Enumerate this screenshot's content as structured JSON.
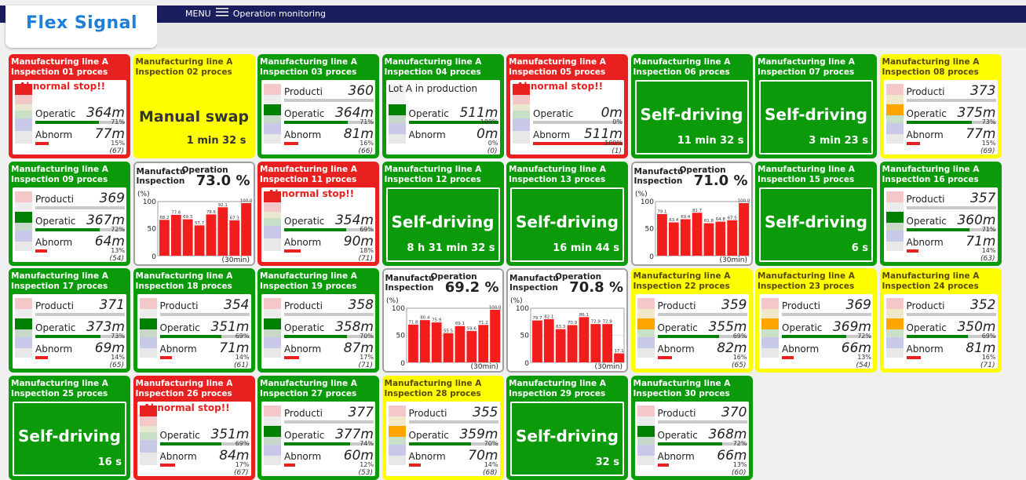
{
  "header": {
    "logo": "Flex Signal",
    "menu_label": "MENU",
    "page_title": "Operation monitoring"
  },
  "labels": {
    "production": "Producti",
    "operation": "Operatic",
    "abnormal": "Abnorm",
    "abnormal_stop": "Abnormal stop!!",
    "self_driving": "Self-driving",
    "manual_swap": "Manual swap",
    "chart_line": "Manufactu",
    "chart_inspection": "Inspection",
    "chart_operation": "Operation",
    "chart_unit": "(%)",
    "chart_interval": "(30min)"
  },
  "colors": {
    "green": "#0a9a0a",
    "red": "#e82020",
    "yellow": "#ffff00",
    "navy": "#1a1e5e"
  },
  "cards": [
    {
      "line": "Manufacturing line A",
      "insp": "Inspection 01 proces",
      "color": "red",
      "kind": "abnormal",
      "op": "364m",
      "op_pct": "71%",
      "op_frac": 0.71,
      "ab": "77m",
      "ab_pct": "15%",
      "ab_frac": 0.15,
      "count": "(67)"
    },
    {
      "line": "Manufacturing line A",
      "insp": "Inspection 02 proces",
      "color": "yellow",
      "kind": "manual",
      "time": "1 min 32 s"
    },
    {
      "line": "Manufacturing line A",
      "insp": "Inspection 03 proces",
      "color": "green",
      "kind": "prod",
      "prod": "360",
      "prod_frac": 1,
      "op": "364m",
      "op_pct": "71%",
      "op_frac": 0.71,
      "ab": "81m",
      "ab_pct": "16%",
      "ab_frac": 0.16,
      "count": "(66)"
    },
    {
      "line": "Manufacturing line A",
      "insp": "Inspection 04 proces",
      "color": "green",
      "kind": "lot",
      "lot": "Lot A in production",
      "op": "511m",
      "op_pct": "100%",
      "op_frac": 1,
      "ab": "0m",
      "ab_pct": "0%",
      "ab_frac": 0,
      "count": "(0)"
    },
    {
      "line": "Manufacturing line A",
      "insp": "Inspection 05 proces",
      "color": "red",
      "kind": "abnormal",
      "op": "0m",
      "op_pct": "0%",
      "op_frac": 0,
      "ab": "511m",
      "ab_pct": "100%",
      "ab_frac": 1,
      "count": "(1)"
    },
    {
      "line": "Manufacturing line A",
      "insp": "Inspection 06 proces",
      "color": "green",
      "kind": "self",
      "time": "11 min 32 s"
    },
    {
      "line": "Manufacturing line A",
      "insp": "Inspection 07 proces",
      "color": "green",
      "kind": "self",
      "time": "3 min 23 s"
    },
    {
      "line": "Manufacturing line A",
      "insp": "Inspection 08 proces",
      "color": "yellow",
      "kind": "prod",
      "prod": "373",
      "prod_frac": 1,
      "op": "375m",
      "op_pct": "73%",
      "op_frac": 0.73,
      "ab": "77m",
      "ab_pct": "15%",
      "ab_frac": 0.15,
      "count": "(69)"
    },
    {
      "line": "Manufacturing line A",
      "insp": "Inspection 09 proces",
      "color": "green",
      "kind": "prod",
      "prod": "369",
      "prod_frac": 1,
      "op": "367m",
      "op_pct": "72%",
      "op_frac": 0.72,
      "ab": "64m",
      "ab_pct": "13%",
      "ab_frac": 0.13,
      "count": "(54)"
    },
    {
      "kind": "chart",
      "color": "gray",
      "rate": "73.0 %",
      "bars": [
        68.2,
        77.6,
        69.3,
        57.7,
        78.6,
        92.1,
        67.3,
        100.0
      ]
    },
    {
      "line": "Manufacturing line A",
      "insp": "Inspection 11 proces",
      "color": "red",
      "kind": "abnormal",
      "op": "354m",
      "op_pct": "69%",
      "op_frac": 0.69,
      "ab": "90m",
      "ab_pct": "18%",
      "ab_frac": 0.18,
      "count": "(71)"
    },
    {
      "line": "Manufacturing line A",
      "insp": "Inspection 12 proces",
      "color": "green",
      "kind": "self",
      "time": "8 h 31 min 32 s"
    },
    {
      "line": "Manufacturing line A",
      "insp": "Inspection 13 proces",
      "color": "green",
      "kind": "self",
      "time": "16 min 44 s"
    },
    {
      "kind": "chart",
      "color": "gray",
      "rate": "71.0 %",
      "bars": [
        79.1,
        63.4,
        69.4,
        81.7,
        61.8,
        64.8,
        67.5,
        100.0
      ]
    },
    {
      "line": "Manufacturing line A",
      "insp": "Inspection 15 proces",
      "color": "green",
      "kind": "self",
      "time": "6 s"
    },
    {
      "line": "Manufacturing line A",
      "insp": "Inspection 16 proces",
      "color": "green",
      "kind": "prod",
      "prod": "357",
      "prod_frac": 1,
      "op": "360m",
      "op_pct": "71%",
      "op_frac": 0.71,
      "ab": "71m",
      "ab_pct": "14%",
      "ab_frac": 0.14,
      "count": "(63)"
    },
    {
      "line": "Manufacturing line A",
      "insp": "Inspection 17 proces",
      "color": "green",
      "kind": "prod",
      "prod": "371",
      "prod_frac": 1,
      "op": "373m",
      "op_pct": "73%",
      "op_frac": 0.73,
      "ab": "69m",
      "ab_pct": "14%",
      "ab_frac": 0.14,
      "count": "(65)"
    },
    {
      "line": "Manufacturing line A",
      "insp": "Inspection 18 proces",
      "color": "green",
      "kind": "prod",
      "prod": "354",
      "prod_frac": 1,
      "op": "351m",
      "op_pct": "69%",
      "op_frac": 0.69,
      "ab": "71m",
      "ab_pct": "14%",
      "ab_frac": 0.14,
      "count": "(61)"
    },
    {
      "line": "Manufacturing line A",
      "insp": "Inspection 19 proces",
      "color": "green",
      "kind": "prod",
      "prod": "358",
      "prod_frac": 1,
      "op": "358m",
      "op_pct": "70%",
      "op_frac": 0.7,
      "ab": "87m",
      "ab_pct": "17%",
      "ab_frac": 0.17,
      "count": "(71)"
    },
    {
      "kind": "chart",
      "color": "gray",
      "rate": "69.2 %",
      "bars": [
        71.8,
        80.4,
        75.9,
        55.5,
        69.1,
        59.6,
        71.2,
        100.0
      ]
    },
    {
      "kind": "chart",
      "color": "gray",
      "rate": "70.8 %",
      "bars": [
        79.7,
        82.1,
        63.3,
        70.9,
        86.1,
        72.9,
        72.9,
        17.1
      ]
    },
    {
      "line": "Manufacturing line A",
      "insp": "Inspection 22 proces",
      "color": "yellow",
      "kind": "prod",
      "prod": "359",
      "prod_frac": 1,
      "op": "355m",
      "op_pct": "69%",
      "op_frac": 0.69,
      "ab": "82m",
      "ab_pct": "16%",
      "ab_frac": 0.16,
      "count": "(65)"
    },
    {
      "line": "Manufacturing line A",
      "insp": "Inspection 23 proces",
      "color": "yellow",
      "kind": "prod",
      "prod": "369",
      "prod_frac": 1,
      "op": "369m",
      "op_pct": "72%",
      "op_frac": 0.72,
      "ab": "66m",
      "ab_pct": "13%",
      "ab_frac": 0.13,
      "count": "(54)"
    },
    {
      "line": "Manufacturing line A",
      "insp": "Inspection 24 proces",
      "color": "yellow",
      "kind": "prod",
      "prod": "352",
      "prod_frac": 1,
      "op": "350m",
      "op_pct": "69%",
      "op_frac": 0.69,
      "ab": "81m",
      "ab_pct": "16%",
      "ab_frac": 0.16,
      "count": "(71)"
    },
    {
      "line": "Manufacturing line A",
      "insp": "Inspection 25 proces",
      "color": "green",
      "kind": "self",
      "time": "16 s"
    },
    {
      "line": "Manufacturing line A",
      "insp": "Inspection 26 proces",
      "color": "red",
      "kind": "abnormal",
      "op": "351m",
      "op_pct": "69%",
      "op_frac": 0.69,
      "ab": "84m",
      "ab_pct": "17%",
      "ab_frac": 0.17,
      "count": "(67)"
    },
    {
      "line": "Manufacturing line A",
      "insp": "Inspection 27 proces",
      "color": "green",
      "kind": "prod",
      "prod": "377",
      "prod_frac": 1,
      "op": "377m",
      "op_pct": "74%",
      "op_frac": 0.74,
      "ab": "60m",
      "ab_pct": "12%",
      "ab_frac": 0.12,
      "count": "(53)"
    },
    {
      "line": "Manufacturing line A",
      "insp": "Inspection 28 proces",
      "color": "yellow",
      "kind": "prod",
      "prod": "355",
      "prod_frac": 1,
      "op": "359m",
      "op_pct": "70%",
      "op_frac": 0.7,
      "ab": "70m",
      "ab_pct": "14%",
      "ab_frac": 0.14,
      "count": "(68)"
    },
    {
      "line": "Manufacturing line A",
      "insp": "Inspection 29 proces",
      "color": "green",
      "kind": "self",
      "time": "32 s"
    },
    {
      "line": "Manufacturing line A",
      "insp": "Inspection 30 proces",
      "color": "green",
      "kind": "prod",
      "prod": "370",
      "prod_frac": 1,
      "op": "368m",
      "op_pct": "72%",
      "op_frac": 0.72,
      "ab": "66m",
      "ab_pct": "13%",
      "ab_frac": 0.13,
      "count": "(60)"
    }
  ],
  "chart_data": [
    {
      "type": "bar",
      "title": "Operation",
      "value_label": "73.0 %",
      "ylabel": "(%)",
      "xlabel": "(30min)",
      "ylim": [
        0,
        100
      ],
      "values": [
        68.2,
        77.6,
        69.3,
        57.7,
        78.6,
        92.1,
        67.3,
        100.0
      ]
    },
    {
      "type": "bar",
      "title": "Operation",
      "value_label": "71.0 %",
      "ylabel": "(%)",
      "xlabel": "(30min)",
      "ylim": [
        0,
        100
      ],
      "values": [
        79.1,
        63.4,
        69.4,
        81.7,
        61.8,
        64.8,
        67.5,
        100.0
      ]
    },
    {
      "type": "bar",
      "title": "Operation",
      "value_label": "69.2 %",
      "ylabel": "(%)",
      "xlabel": "(30min)",
      "ylim": [
        0,
        100
      ],
      "values": [
        71.8,
        80.4,
        75.9,
        55.5,
        69.1,
        59.6,
        71.2,
        100.0
      ]
    },
    {
      "type": "bar",
      "title": "Operation",
      "value_label": "70.8 %",
      "ylabel": "(%)",
      "xlabel": "(30min)",
      "ylim": [
        0,
        100
      ],
      "values": [
        79.7,
        82.1,
        63.3,
        70.9,
        86.1,
        72.9,
        72.9,
        17.1
      ]
    }
  ]
}
